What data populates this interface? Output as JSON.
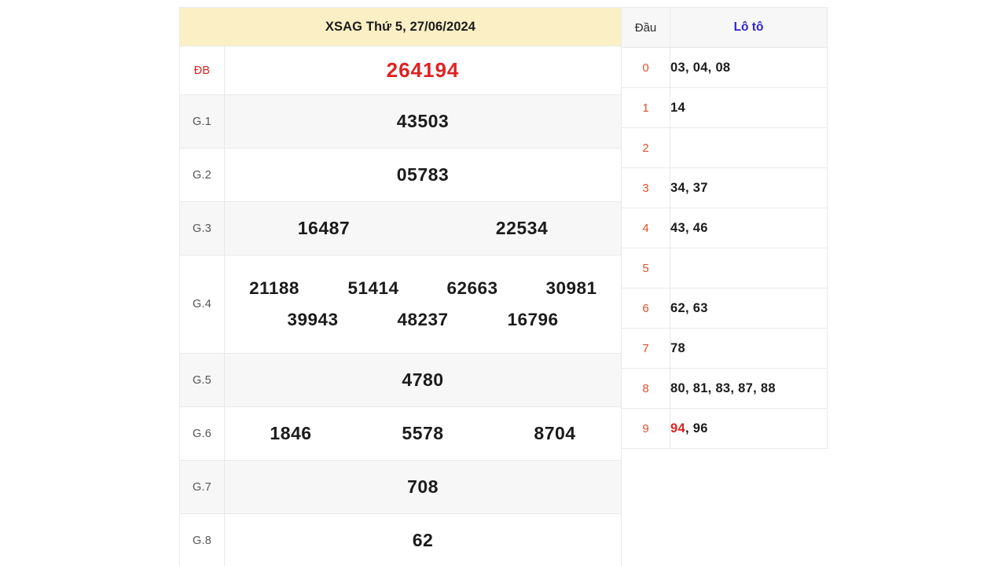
{
  "header": {
    "title": "XSAG Thứ 5, 27/06/2024",
    "region_code": "XSAG",
    "weekday": "Thứ 5",
    "date": "27/06/2024"
  },
  "prize_table": {
    "rows": [
      {
        "label": "ĐB",
        "numbers": [
          "264194"
        ]
      },
      {
        "label": "G.1",
        "numbers": [
          "43503"
        ]
      },
      {
        "label": "G.2",
        "numbers": [
          "05783"
        ]
      },
      {
        "label": "G.3",
        "numbers": [
          "16487",
          "22534"
        ]
      },
      {
        "label": "G.4",
        "numbers_row1": [
          "21188",
          "51414",
          "62663",
          "30981"
        ],
        "numbers_row2": [
          "39943",
          "48237",
          "16796"
        ]
      },
      {
        "label": "G.5",
        "numbers": [
          "4780"
        ]
      },
      {
        "label": "G.6",
        "numbers": [
          "1846",
          "5578",
          "8704"
        ]
      },
      {
        "label": "G.7",
        "numbers": [
          "708"
        ]
      },
      {
        "label": "G.8",
        "numbers": [
          "62"
        ]
      }
    ]
  },
  "loto_table": {
    "headers": {
      "dau": "Đầu",
      "loto": "Lô tô"
    },
    "rows": [
      {
        "dau": "0",
        "numbers": "03, 04, 08"
      },
      {
        "dau": "1",
        "numbers": "14"
      },
      {
        "dau": "2",
        "numbers": ""
      },
      {
        "dau": "3",
        "numbers": "34, 37"
      },
      {
        "dau": "4",
        "numbers": "43, 46"
      },
      {
        "dau": "5",
        "numbers": ""
      },
      {
        "dau": "6",
        "numbers": "62, 63"
      },
      {
        "dau": "7",
        "numbers": "78"
      },
      {
        "dau": "8",
        "numbers": "80, 81, 83, 87, 88"
      },
      {
        "dau": "9",
        "highlight": "94",
        "numbers": ", 96"
      }
    ]
  },
  "colors": {
    "header_bg": "#fbf0c5",
    "special_red": "#e02222",
    "loto_blue": "#3023d0",
    "dau_orange": "#e0502a",
    "row_grey": "#f7f7f7",
    "border": "#e9e9e9"
  }
}
